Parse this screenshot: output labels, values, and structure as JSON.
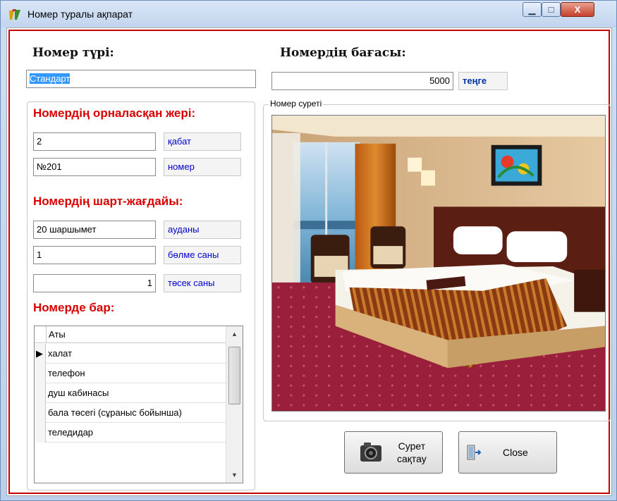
{
  "window": {
    "title": "Номер туралы ақпарат",
    "minimize_glyph": "▁",
    "maximize_glyph": "□",
    "close_glyph": "X"
  },
  "room_type": {
    "label": "Номер түрі:",
    "value": "Стандарт"
  },
  "price": {
    "label": "Номердің бағасы:",
    "value": "5000",
    "unit": "теңге"
  },
  "location": {
    "title": "Номердің орналасқан жері:",
    "floor_value": "2",
    "floor_label": "қабат",
    "number_value": "№201",
    "number_label": "номер"
  },
  "condition": {
    "title": "Номердің шарт-жағдайы:",
    "area_value": "20 шаршымет",
    "area_label": "ауданы",
    "rooms_value": "1",
    "rooms_label": "бөлме саны",
    "beds_value": "1",
    "beds_label": "төсек саны"
  },
  "amenities": {
    "title": "Номерде бар:",
    "column": "Аты",
    "rows": [
      "халат",
      "телефон",
      "душ кабинасы",
      "бала төсегі (сұраныс бойынша)",
      "теледидар"
    ],
    "current_marker": "▶",
    "scroll_up": "▲",
    "scroll_down": "▼"
  },
  "photo": {
    "legend": "Номер суреті"
  },
  "buttons": {
    "save_photo": "Сурет\nсақтау",
    "close": "Close"
  },
  "icons": {
    "app": "app-logo-icon",
    "camera": "camera-icon",
    "exit": "exit-door-icon"
  }
}
